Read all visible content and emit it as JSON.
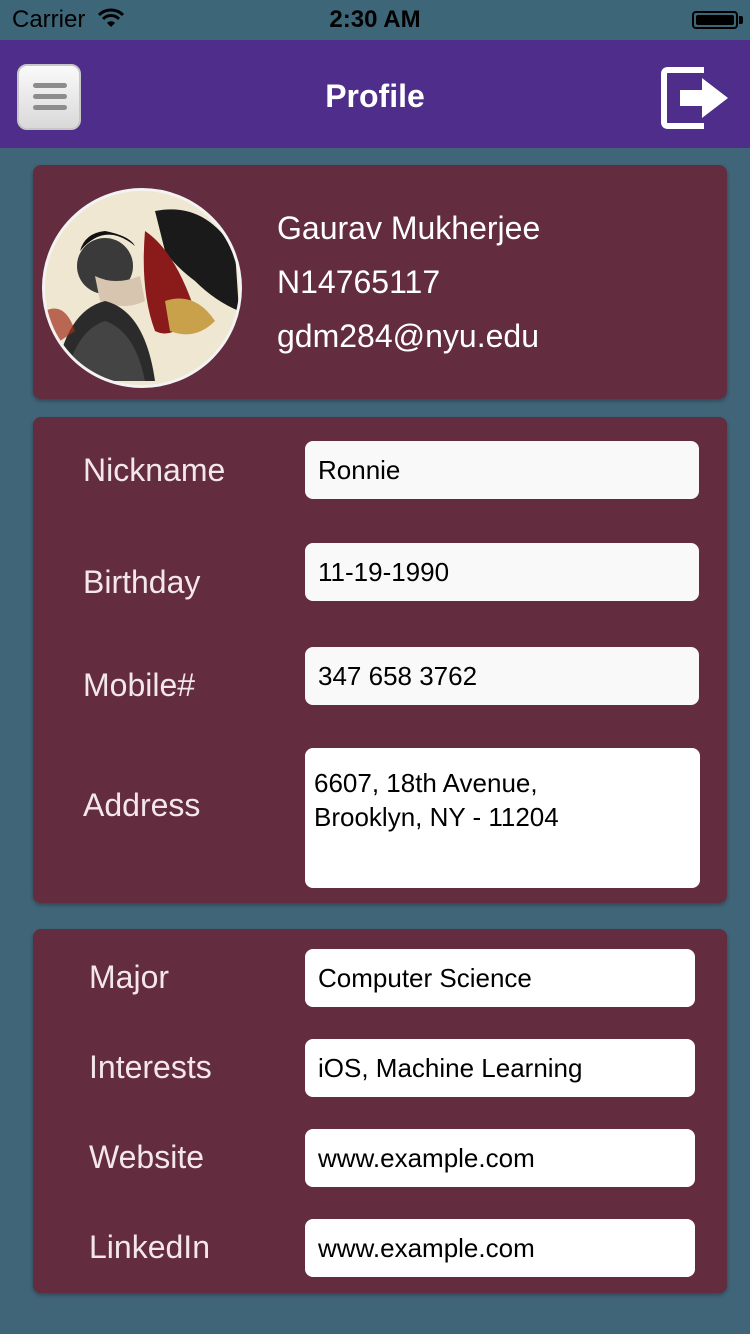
{
  "status_bar": {
    "carrier": "Carrier",
    "time": "2:30 AM"
  },
  "nav": {
    "title": "Profile",
    "menu_icon": "hamburger-menu-icon",
    "logout_icon": "logout-arrow-icon"
  },
  "profile": {
    "name": "Gaurav Mukherjee",
    "id": "N14765117",
    "email": "gdm284@nyu.edu"
  },
  "personal": {
    "nickname": {
      "label": "Nickname",
      "value": "Ronnie"
    },
    "birthday": {
      "label": "Birthday",
      "value": "11-19-1990"
    },
    "mobile": {
      "label": "Mobile#",
      "value": "347 658 3762"
    },
    "address": {
      "label": "Address",
      "line1": "6607, 18th Avenue,",
      "line2": "Brooklyn, NY - 11204"
    }
  },
  "academic": {
    "major": {
      "label": "Major",
      "value": "Computer Science"
    },
    "interests": {
      "label": "Interests",
      "value": "iOS, Machine Learning"
    },
    "website": {
      "label": "Website",
      "value": "www.example.com"
    },
    "linkedin": {
      "label": "LinkedIn",
      "value": "www.example.com"
    }
  },
  "colors": {
    "background": "#416578",
    "nav_bar": "#4e2d8b",
    "card": "#632c3f"
  }
}
